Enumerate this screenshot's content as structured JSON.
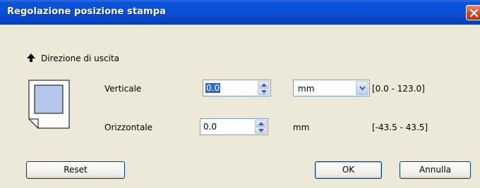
{
  "window": {
    "title": "Regolazione posizione stampa"
  },
  "output_direction": {
    "label": "Direzione di uscita",
    "icon": "arrow-up-icon"
  },
  "paper_icon": "paper-icon",
  "vertical": {
    "label": "Verticale",
    "value": "0.0",
    "unit": "mm",
    "range": "[0.0 - 123.0]"
  },
  "horizontal": {
    "label": "Orizzontale",
    "value": "0.0",
    "unit": "mm",
    "range": "[-43.5 - 43.5]"
  },
  "buttons": {
    "reset": "Reset",
    "ok": "OK",
    "cancel": "Annulla"
  },
  "colors": {
    "titlebar": "#0A53DA",
    "dialog_bg": "#ECE9D8",
    "selection": "#316AC5",
    "close": "#D2451E"
  }
}
